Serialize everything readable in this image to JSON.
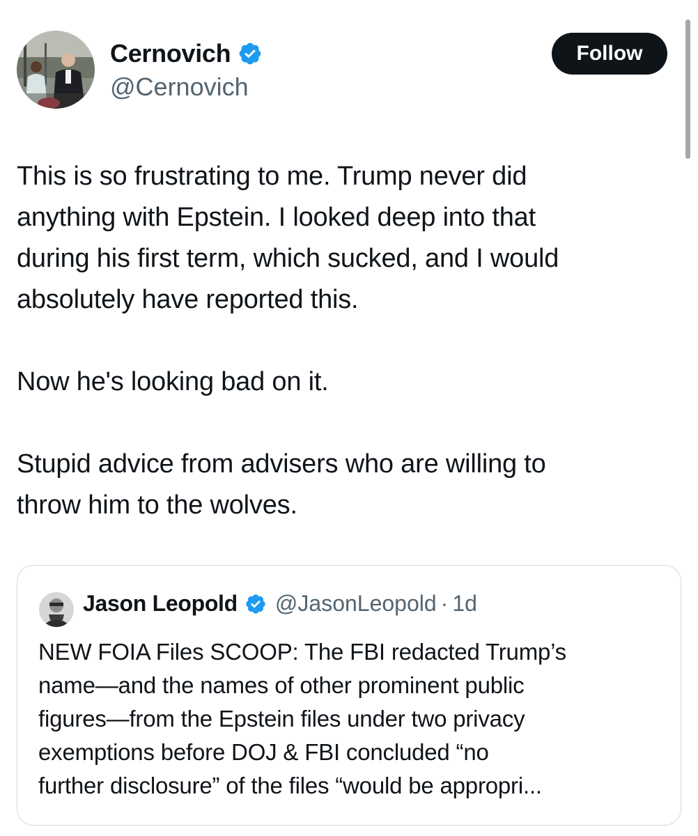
{
  "author": {
    "display_name": "Cernovich",
    "handle": "@Cernovich",
    "verified_icon": "verified-badge-icon"
  },
  "follow_label": "Follow",
  "tweet": {
    "lines": [
      "This is so frustrating to me. Trump never did",
      "anything with Epstein. I looked deep into that",
      "during his first term, which sucked, and I would",
      "absolutely have reported this."
    ],
    "line_2": "Now he's looking bad on it.",
    "lines_3": [
      "Stupid advice from advisers who are willing to",
      "throw him to the wolves."
    ]
  },
  "quoted_tweet": {
    "display_name": "Jason Leopold",
    "handle": "@JasonLeopold",
    "separator": "·",
    "time": "1d",
    "lines": [
      "NEW FOIA Files SCOOP: The FBI redacted Trump’s",
      "name—and the names of other prominent public",
      "figures—from the Epstein files under two privacy",
      "exemptions before DOJ & FBI concluded  “no",
      "further disclosure” of the files “would be appropri..."
    ]
  },
  "colors": {
    "text": "#0f1419",
    "secondary": "#536471",
    "verified": "#1d9bf0",
    "follow_bg": "#0f1419",
    "border": "#cfd9de"
  }
}
